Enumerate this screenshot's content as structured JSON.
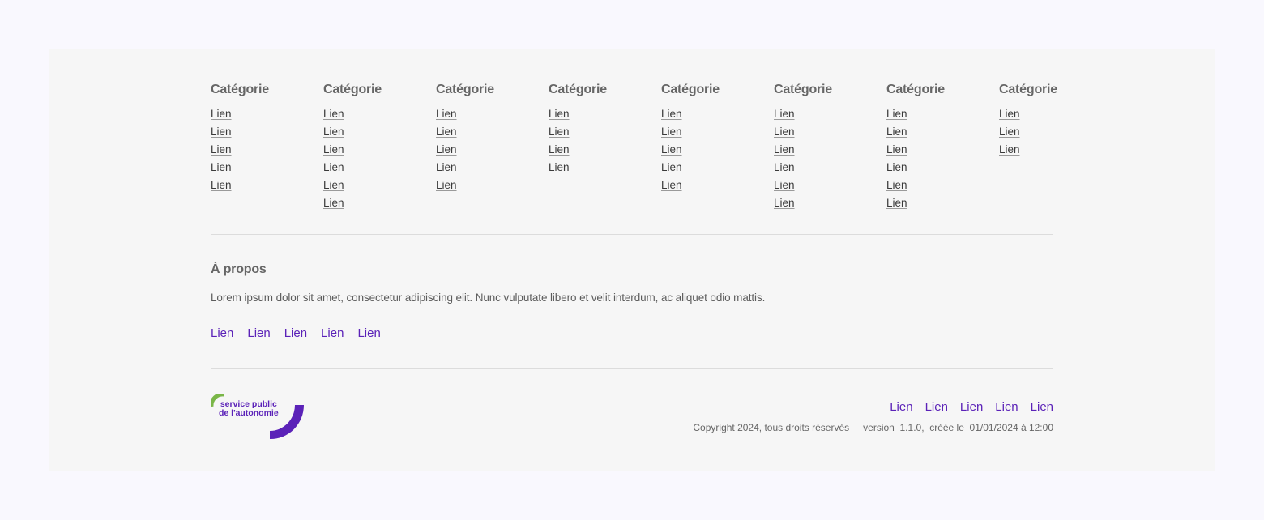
{
  "columns": [
    {
      "title": "Catégorie",
      "links": [
        "Lien",
        "Lien",
        "Lien",
        "Lien",
        "Lien"
      ]
    },
    {
      "title": "Catégorie",
      "links": [
        "Lien",
        "Lien",
        "Lien",
        "Lien",
        "Lien",
        "Lien"
      ]
    },
    {
      "title": "Catégorie",
      "links": [
        "Lien",
        "Lien",
        "Lien",
        "Lien",
        "Lien"
      ]
    },
    {
      "title": "Catégorie",
      "links": [
        "Lien",
        "Lien",
        "Lien",
        "Lien"
      ]
    },
    {
      "title": "Catégorie",
      "links": [
        "Lien",
        "Lien",
        "Lien",
        "Lien",
        "Lien"
      ]
    },
    {
      "title": "Catégorie",
      "links": [
        "Lien",
        "Lien",
        "Lien",
        "Lien",
        "Lien",
        "Lien"
      ]
    },
    {
      "title": "Catégorie",
      "links": [
        "Lien",
        "Lien",
        "Lien",
        "Lien",
        "Lien",
        "Lien"
      ]
    },
    {
      "title": "Catégorie",
      "links": [
        "Lien",
        "Lien",
        "Lien"
      ]
    }
  ],
  "about": {
    "title": "À propos",
    "text": "Lorem ipsum dolor sit amet, consectetur adipiscing elit. Nunc vulputate libero et velit interdum, ac aliquet odio mattis.",
    "links": [
      "Lien",
      "Lien",
      "Lien",
      "Lien",
      "Lien"
    ]
  },
  "logo": {
    "line1": "service public",
    "line2": "de l'autonomie",
    "accent_green": "#7ab648",
    "accent_purple": "#5b22b8"
  },
  "bottom": {
    "links": [
      "Lien",
      "Lien",
      "Lien",
      "Lien",
      "Lien"
    ],
    "copyright": "Copyright 2024, tous droits réservés",
    "version": "version  1.1.0,  créée le  01/01/2024 à 12:00"
  },
  "colors": {
    "page_bg": "#f9f8fe",
    "footer_bg": "#f6f6f6",
    "link_purple": "#5b22b8"
  }
}
